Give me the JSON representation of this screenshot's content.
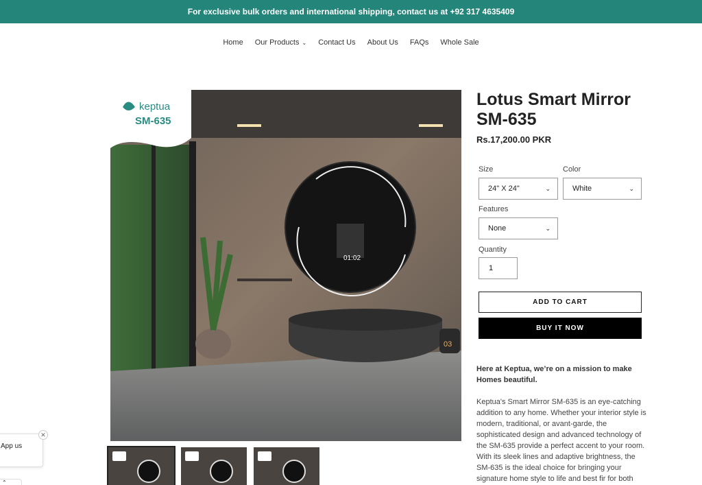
{
  "announcement": {
    "text": "For exclusive bulk orders and international shipping, contact us at +92 317 4635409"
  },
  "nav": {
    "items": [
      {
        "label": "Home"
      },
      {
        "label": "Our Products",
        "has_dropdown": true
      },
      {
        "label": "Contact Us"
      },
      {
        "label": "About Us"
      },
      {
        "label": "FAQs"
      },
      {
        "label": "Whole Sale"
      }
    ]
  },
  "gallery": {
    "brand": "keptua",
    "model": "SM-635",
    "clock": "01:02",
    "watermark": "Keptua",
    "planter_display": "03",
    "thumbnails": 3
  },
  "product": {
    "title_line1": "Lotus Smart Mirror",
    "title_line2": "SM-635",
    "price": "Rs.17,200.00 PKR",
    "size_label": "Size",
    "size_value": "24\" X 24\"",
    "color_label": "Color",
    "color_value": "White",
    "features_label": "Features",
    "features_value": "None",
    "quantity_label": "Quantity",
    "quantity_value": "1",
    "add_to_cart": "ADD TO CART",
    "buy_now": "BUY IT NOW",
    "desc_lead": "Here at Keptua, we’re on a mission to make Homes beautiful.",
    "description": "Keptua's Smart Mirror SM-635 is an eye-catching addition to any home.  Whether your interior style is modern, traditional, or avant-garde, the sophisticated design and advanced technology of the SM-635 provide a perfect accent to your room. With its sleek lines and adaptive brightness, the SM-635 is the ideal choice for bringing your signature home style to life and best fir for both"
  },
  "popup": {
    "text": "App us"
  },
  "colors": {
    "announcement_bg": "#24857a",
    "buy_bg": "#000000",
    "brand_teal": "#2a8b83"
  }
}
